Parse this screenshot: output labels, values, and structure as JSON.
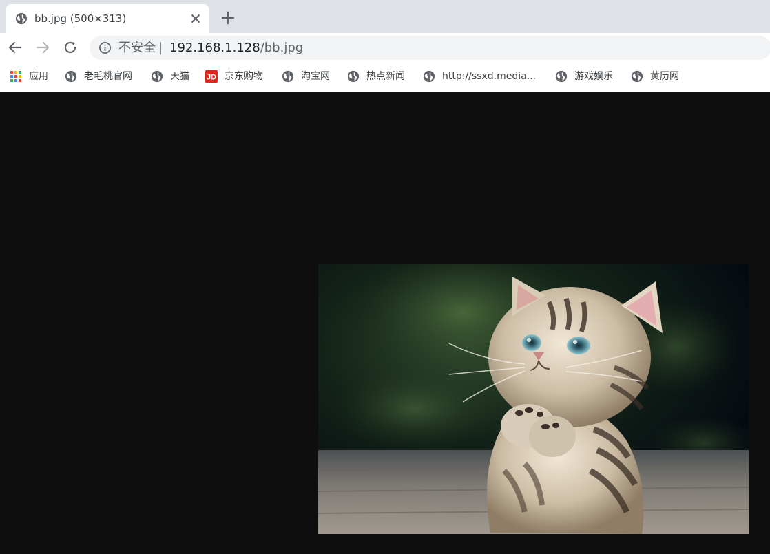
{
  "tab": {
    "title": "bb.jpg (500×313)",
    "favicon": "globe-icon"
  },
  "toolbar": {
    "security_label": "不安全",
    "separator": "|",
    "url_host": "192.168.1.128",
    "url_path": "/bb.jpg"
  },
  "bookmarks": [
    {
      "label": "应用",
      "icon": "apps-grid-icon"
    },
    {
      "label": "老毛桃官网",
      "icon": "globe-icon"
    },
    {
      "label": "天猫",
      "icon": "globe-icon"
    },
    {
      "label": "京东购物",
      "icon": "jd-logo-icon"
    },
    {
      "label": "淘宝网",
      "icon": "globe-icon"
    },
    {
      "label": "热点新闻",
      "icon": "globe-icon"
    },
    {
      "label": "http://ssxd.media...",
      "icon": "globe-icon"
    },
    {
      "label": "游戏娱乐",
      "icon": "globe-icon"
    },
    {
      "label": "黄历网",
      "icon": "globe-icon"
    }
  ],
  "content": {
    "background": "#0e0e0e",
    "image_subject": "kitten-photo"
  },
  "colors": {
    "jd_red": "#e1251b",
    "tab_strip": "#dee1e6"
  }
}
